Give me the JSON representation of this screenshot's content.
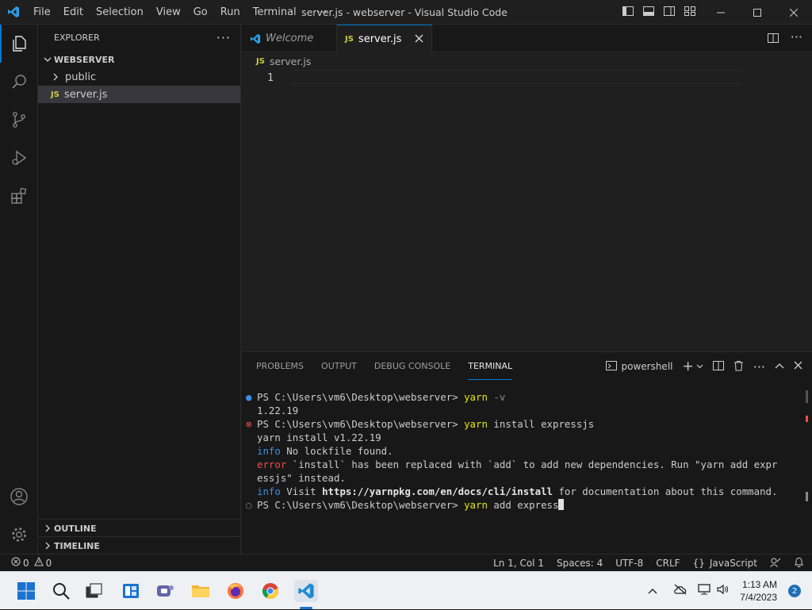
{
  "window": {
    "title": "server.js - webserver - Visual Studio Code",
    "menu": [
      "File",
      "Edit",
      "Selection",
      "View",
      "Go",
      "Run",
      "Terminal",
      "⋯"
    ]
  },
  "sidebar": {
    "header": "EXPLORER",
    "folder": "WEBSERVER",
    "items": [
      {
        "label": "public",
        "type": "folder"
      },
      {
        "label": "server.js",
        "type": "file",
        "badge": "JS"
      }
    ],
    "outline": "OUTLINE",
    "timeline": "TIMELINE"
  },
  "editor": {
    "tabs": [
      {
        "label": "Welcome",
        "active": false
      },
      {
        "label": "server.js",
        "active": true,
        "badge": "JS"
      }
    ],
    "breadcrumb": "server.js",
    "breadcrumb_badge": "JS",
    "line_number": "1"
  },
  "panel": {
    "tabs": [
      "PROBLEMS",
      "OUTPUT",
      "DEBUG CONSOLE",
      "TERMINAL"
    ],
    "active_tab": "TERMINAL",
    "shell": "powershell",
    "terminal": {
      "l1_prompt": "PS C:\\Users\\vm6\\Desktop\\webserver> ",
      "l1_cmd": "yarn",
      "l1_arg": " -v",
      "l2": "1.22.19",
      "l3_prompt": "PS C:\\Users\\vm6\\Desktop\\webserver> ",
      "l3_cmd": "yarn",
      "l3_arg": " install expressjs",
      "l4": "yarn install v1.22.19",
      "l5_tag": "info",
      "l5_text": " No lockfile found.",
      "l6_tag": "error",
      "l6_text": " `install` has been replaced with `add` to add new dependencies. Run \"yarn add expr",
      "l7": "essjs\" instead.",
      "l8_tag": "info",
      "l8_text": " Visit ",
      "l8_url": "https://yarnpkg.com/en/docs/cli/install",
      "l8_tail": " for documentation about this command.",
      "l9_prompt": "PS C:\\Users\\vm6\\Desktop\\webserver> ",
      "l9_cmd": "yarn",
      "l9_arg": " add express"
    }
  },
  "status": {
    "errors": "0",
    "warnings": "0",
    "position": "Ln 1, Col 1",
    "spaces": "Spaces: 4",
    "encoding": "UTF-8",
    "eol": "CRLF",
    "language": "JavaScript",
    "language_glyph": "{}"
  },
  "taskbar": {
    "time": "1:13 AM",
    "date": "7/4/2023",
    "notifications": "2"
  },
  "colors": {
    "accent": "#0078d4",
    "js_badge": "#cbcb41",
    "terminal_yellow": "#e5e510",
    "terminal_blue": "#3b8eea",
    "terminal_red": "#f14c4c"
  }
}
